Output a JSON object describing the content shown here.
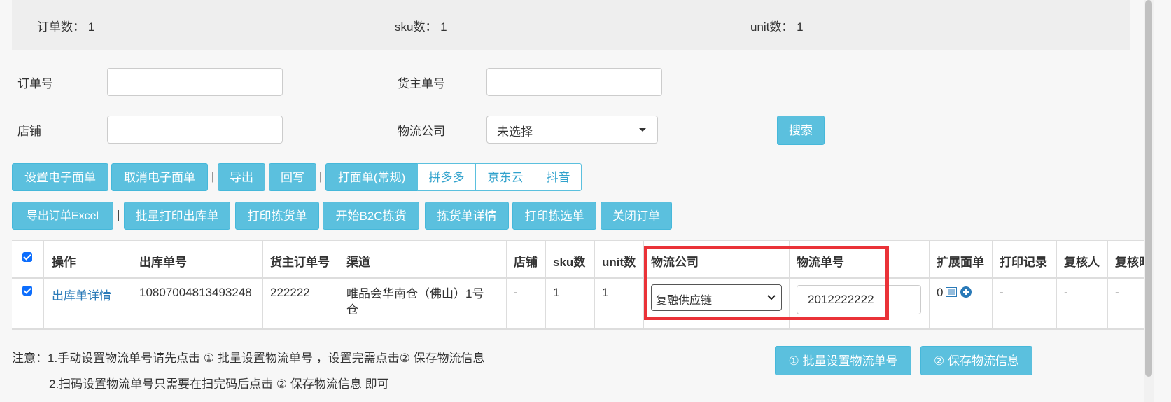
{
  "summary": {
    "orders": "订单数：  1",
    "sku": "sku数：  1",
    "units": "unit数：  1"
  },
  "form": {
    "order_no_label": "订单号",
    "owner_no_label": "货主单号",
    "shop_label": "店铺",
    "carrier_label": "物流公司",
    "carrier_selected": "未选择",
    "search_label": "搜索"
  },
  "toolbar1": {
    "set_eform": "设置电子面单",
    "cancel_eform": "取消电子面单",
    "export": "导出",
    "writeback": "回写",
    "print_regular": "打面单(常规)",
    "pdd": "拼多多",
    "jdcloud": "京东云",
    "douyin": "抖音",
    "sep": "|"
  },
  "toolbar2": {
    "export_excel": "导出订单Excel",
    "batch_print_out": "批量打印出库单",
    "print_pick": "打印拣货单",
    "start_b2c": "开始B2C拣货",
    "pick_detail": "拣货单详情",
    "print_select": "打印拣选单",
    "close_order": "关闭订单",
    "sep": "|"
  },
  "table": {
    "headers": [
      "操作",
      "出库单号",
      "货主订单号",
      "渠道",
      "店铺",
      "sku数",
      "unit数",
      "物流公司",
      "物流单号",
      "扩展面单",
      "打印记录",
      "复核人",
      "复核时"
    ],
    "row": {
      "action": "出库单详情",
      "outbound_no": "10807004813493248",
      "owner_order_no": "222222",
      "channel": "唯品会华南仓（佛山）1号仓",
      "shop": "-",
      "sku": "1",
      "unit": "1",
      "carrier": "复融供应链",
      "tracking_no": "2012222222",
      "ext_count": "0",
      "print_record": "-",
      "reviewer": "-",
      "review_time": "-"
    }
  },
  "notes": {
    "line1": "注意：1.手动设置物流单号请先点击 ① 批量设置物流单号 ，设置完需点击② 保存物流信息",
    "line2": "2.扫码设置物流单号只需要在扫完码后点击 ② 保存物流信息 即可"
  },
  "actions": {
    "batch_set": "① 批量设置物流单号",
    "save": "② 保存物流信息"
  },
  "colors": {
    "primary_btn": "#5bc0de",
    "highlight": "#ea3238",
    "link": "#2a7ab8"
  }
}
